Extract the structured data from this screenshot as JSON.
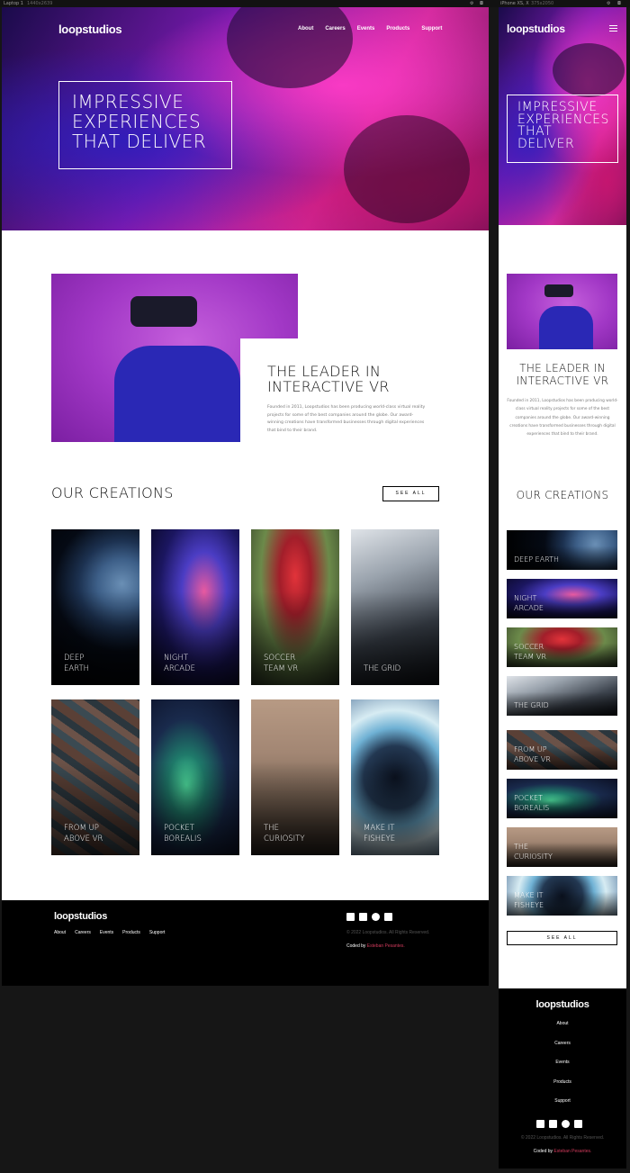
{
  "toolbar": {
    "laptop_label": "Laptop 1",
    "laptop_size": "1440x2639",
    "phone_label": "iPhone XS, X",
    "phone_size": "375x2050"
  },
  "brand": {
    "logo": "loopstudios"
  },
  "nav": [
    "About",
    "Careers",
    "Events",
    "Products",
    "Support"
  ],
  "hero": {
    "laptop_title": "Impressive experiences that deliver",
    "phone_title": "Impressive experiences that deliver"
  },
  "about": {
    "title": "The leader in interactive VR",
    "text": "Founded in 2011, Loopstudios has been producing world-class virtual reality projects for some of the best companies around the globe. Our award-winning creations have transformed businesses through digital experiences that bind to their brand."
  },
  "creations": {
    "title": "Our creations",
    "see_all": "See all",
    "items": [
      {
        "label": "Deep\nEarth",
        "phone_label": "Deep Earth",
        "art": "earth"
      },
      {
        "label": "Night\nArcade",
        "phone_label": "Night\nArcade",
        "art": "arcade"
      },
      {
        "label": "Soccer\nTeam VR",
        "phone_label": "Soccer\nTeam VR",
        "art": "soccer"
      },
      {
        "label": "The Grid",
        "phone_label": "The Grid",
        "art": "grid"
      },
      {
        "label": "From up\nabove VR",
        "phone_label": "From up\nabove VR",
        "art": "above"
      },
      {
        "label": "Pocket\nBorealis",
        "phone_label": "Pocket\nBorealis",
        "art": "borealis"
      },
      {
        "label": "The\nCuriosity",
        "phone_label": "The\nCuriosity",
        "art": "curiosity"
      },
      {
        "label": "Make it\nFisheye",
        "phone_label": "Make it\nFisheye",
        "art": "fisheye"
      }
    ]
  },
  "footer": {
    "logo": "loopstudios",
    "copyright": "© 2022 Loopstudios. All Rights Reserved.",
    "coded_by_prefix": "Coded by",
    "coded_by_name": "Esteban Pesantes.",
    "social_icons": [
      "facebook-icon",
      "twitter-icon",
      "pinterest-icon",
      "instagram-icon"
    ]
  }
}
